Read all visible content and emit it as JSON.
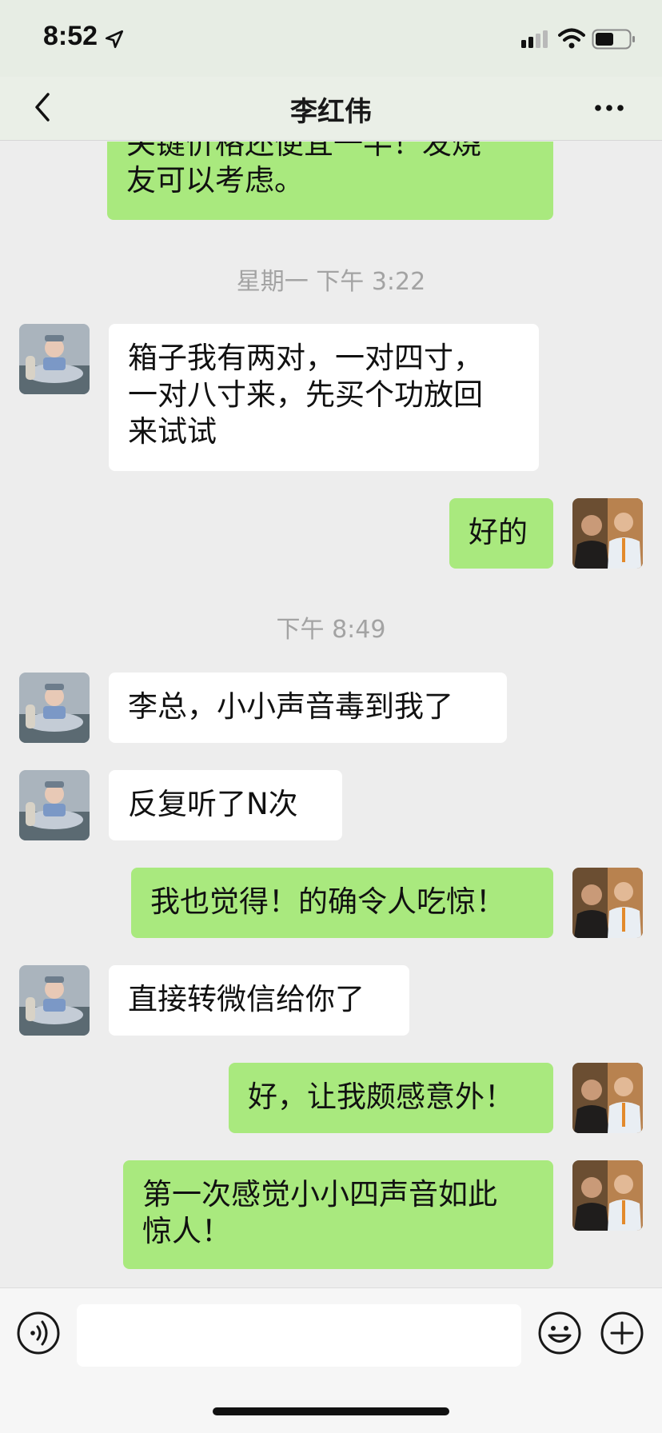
{
  "status_bar": {
    "time": "8:52",
    "icons": [
      "location-arrow-icon",
      "cellular-signal-icon",
      "wifi-icon",
      "battery-icon"
    ]
  },
  "nav": {
    "title": "李红伟",
    "back_icon": "chevron-left-icon",
    "more_icon": "ellipsis-icon"
  },
  "messages": [
    {
      "kind": "text",
      "side": "right",
      "text": "关键价格还便宜一半！发烧友可以考虑。",
      "lines": [
        "关键价格还便宜一半！发烧",
        "友可以考虑。"
      ]
    },
    {
      "kind": "timestamp",
      "text": "星期一 下午 3:22"
    },
    {
      "kind": "text",
      "side": "left",
      "lines": [
        "箱子我有两对，一对四寸，",
        "一对八寸来，先买个功放回",
        "来试试"
      ]
    },
    {
      "kind": "text",
      "side": "right",
      "lines": [
        "好的"
      ]
    },
    {
      "kind": "timestamp",
      "text": "下午 8:49"
    },
    {
      "kind": "text",
      "side": "left",
      "lines": [
        "李总，小小声音毒到我了"
      ]
    },
    {
      "kind": "text",
      "side": "left",
      "lines": [
        "反复听了N次"
      ]
    },
    {
      "kind": "text",
      "side": "right",
      "lines": [
        "我也觉得！的确令人吃惊！"
      ]
    },
    {
      "kind": "text",
      "side": "left",
      "lines": [
        "直接转微信给你了"
      ]
    },
    {
      "kind": "text",
      "side": "right",
      "lines": [
        "好，让我颇感意外！"
      ]
    },
    {
      "kind": "text",
      "side": "right",
      "lines": [
        "第一次感觉小小四声音如此",
        "惊人！"
      ]
    }
  ],
  "input_bar": {
    "placeholder": "",
    "icons": [
      "voice-icon",
      "emoji-icon",
      "plus-icon"
    ]
  },
  "colors": {
    "background": "#ededed",
    "my_bubble": "#a9e97e",
    "their_bubble": "#ffffff",
    "timestamp": "#a3a3a3"
  }
}
